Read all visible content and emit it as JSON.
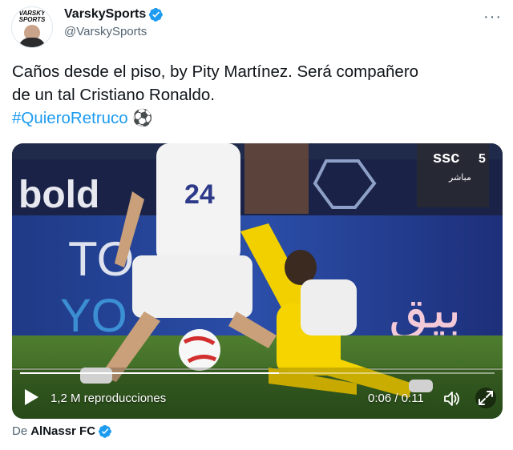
{
  "author": {
    "avatar_logo_line1": "VARSKY",
    "avatar_logo_line2": "SPORTS",
    "display_name": "VarskySports",
    "handle": "@VarskySports"
  },
  "tweet": {
    "text_line1": "Caños desde el piso, by Pity Martínez. Será compañero",
    "text_line2": "de un tal Cristiano Ronaldo.",
    "hashtag": "#QuieroRetruco",
    "emoji": "⚽"
  },
  "video": {
    "views": "1,2 M reproducciones",
    "time": "0:06 / 0:11",
    "progress": 0.545,
    "scene_text": {
      "board_brand": "bold",
      "broadcaster": "ssc",
      "channel": "5",
      "live_label": "مباشر",
      "ad_arabic": "بيق",
      "ad_latin_top": "TO",
      "ad_latin_bottom": "YO",
      "player_number": "24"
    }
  },
  "attribution": {
    "prefix": "De",
    "account": "AlNassr FC"
  },
  "colors": {
    "accent": "#1d9bf0",
    "secondary_text": "#536471",
    "primary_text": "#0f1419"
  }
}
